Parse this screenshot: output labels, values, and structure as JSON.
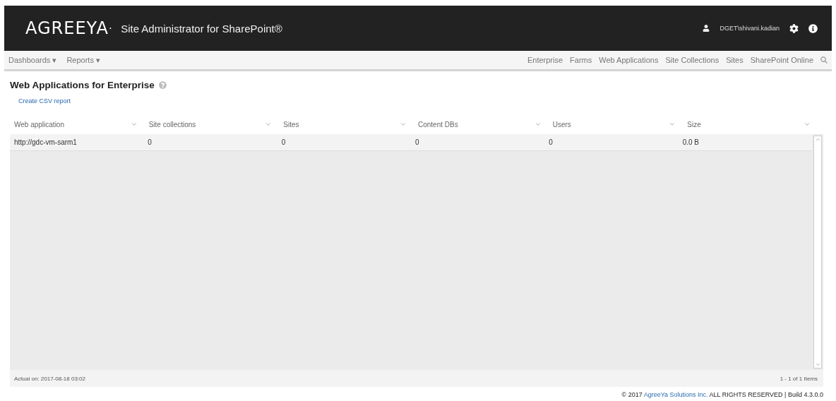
{
  "header": {
    "brand": "AGREEYA",
    "brand_mark": "·",
    "product": "Site Administrator for SharePoint®",
    "user": "DGET\\shivani.kadian"
  },
  "nav": {
    "left": [
      {
        "label": "Dashboards",
        "caret": "▾"
      },
      {
        "label": "Reports",
        "caret": "▾"
      }
    ],
    "right": [
      {
        "label": "Enterprise"
      },
      {
        "label": "Farms"
      },
      {
        "label": "Web Applications"
      },
      {
        "label": "Site Collections"
      },
      {
        "label": "Sites"
      },
      {
        "label": "SharePoint Online"
      }
    ]
  },
  "page": {
    "title": "Web Applications for Enterprise",
    "action": "Create CSV report"
  },
  "table": {
    "columns": [
      "Web application",
      "Site collections",
      "Sites",
      "Content DBs",
      "Users",
      "Size"
    ],
    "rows": [
      [
        "http://gdc-vm-sarm1",
        "0",
        "0",
        "0",
        "0",
        "0.0 B"
      ]
    ]
  },
  "grid_footer": {
    "actual_on": "Actual on: 2017-08-18 03:02",
    "pager": "1 - 1 of 1 Items"
  },
  "copyright": {
    "prefix": "© 2017",
    "link": "AgreeYa Solutions Inc.",
    "suffix": "ALL RIGHTS RESERVED | Build 4.3.0.0"
  }
}
